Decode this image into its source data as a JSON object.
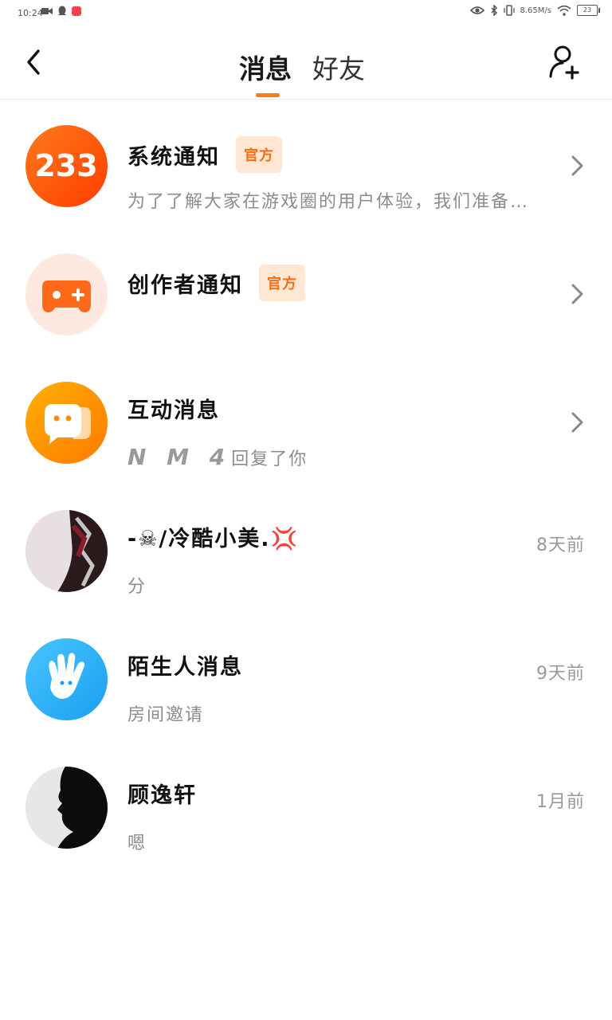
{
  "status_bar": {
    "time": "10:24",
    "speed": "8.65M/s",
    "battery": "23"
  },
  "header": {
    "tabs": [
      {
        "label": "消息",
        "active": true
      },
      {
        "label": "好友",
        "active": false
      }
    ],
    "accent_color": "#ff7a1a"
  },
  "conversations": [
    {
      "title": "系统通知",
      "badge": "官方",
      "preview": "为了了解大家在游戏圈的用户体验，我们准备…",
      "avatar_text": "233"
    },
    {
      "title": "创作者通知",
      "badge": "官方",
      "preview": ""
    },
    {
      "title": "互动消息",
      "preview_strong": "N M 4",
      "preview": "回复了你"
    },
    {
      "title": "-☠/冷酷小美.💢",
      "time": "8天前",
      "preview": "分"
    },
    {
      "title": "陌生人消息",
      "time": "9天前",
      "preview": "房间邀请"
    },
    {
      "title": "顾逸轩",
      "time": "1月前",
      "preview": "嗯"
    }
  ]
}
